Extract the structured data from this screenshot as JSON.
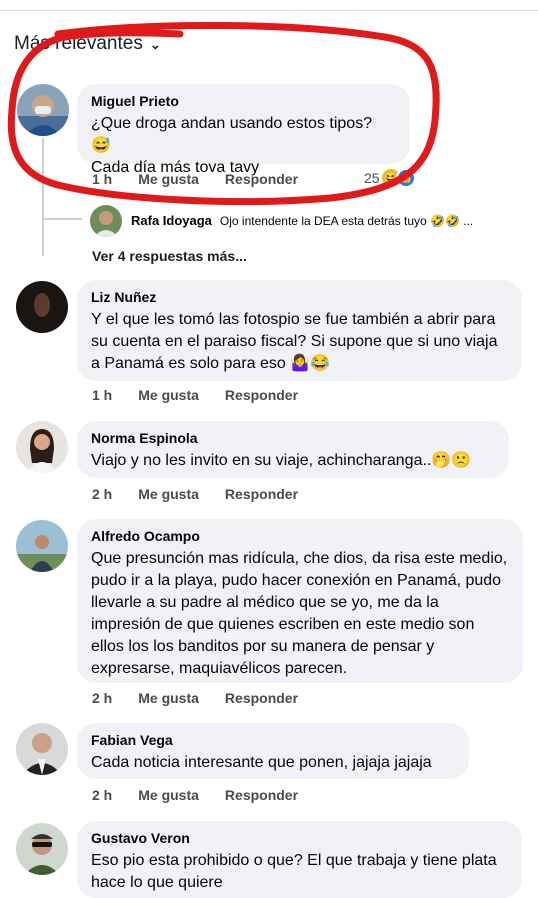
{
  "sort": {
    "label": "Más relevantes"
  },
  "comments": [
    {
      "author": "Miguel Prieto",
      "text": "¿Que droga andan usando estos tipos? 😅\nCada día más tova tavy",
      "time": "1 h",
      "like": "Me gusta",
      "reply": "Responder",
      "reactions": "25"
    },
    {
      "author": "Liz Nuñez",
      "text": "Y el que les tomó las fotospio se fue también a abrir para su cuenta en el paraiso fiscal? Si supone que si uno viaja a Panamá es solo para eso 🤷‍♀️😂",
      "time": "1 h",
      "like": "Me gusta",
      "reply": "Responder"
    },
    {
      "author": "Norma Espinola",
      "text": "Viajo y no les invito en su viaje, achincharanga..🤭🙁",
      "time": "2 h",
      "like": "Me gusta",
      "reply": "Responder"
    },
    {
      "author": "Alfredo Ocampo",
      "text": "Que presunción mas ridícula, che dios, da risa este medio, pudo ir a la playa, pudo hacer conexión en Panamá, pudo llevarle a su padre al médico que se yo, me da la impresión de que quienes escriben en este medio son ellos los los banditos por su manera de pensar y expresarse, maquiavélicos parecen.",
      "time": "2 h",
      "like": "Me gusta",
      "reply": "Responder"
    },
    {
      "author": "Fabian Vega",
      "text": "Cada noticia interesante que ponen, jajaja jajaja",
      "time": "2 h",
      "like": "Me gusta",
      "reply": "Responder"
    },
    {
      "author": "Gustavo Veron",
      "text": "Eso pio esta prohibido o que? El que trabaja y tiene plata hace lo que quiere"
    }
  ],
  "reply_preview": {
    "author": "Rafa Idoyaga",
    "text": "Ojo intendente la DEA esta detrás tuyo 🤣🤣 ..."
  },
  "more_replies": "Ver 4 respuestas más...",
  "colors": {
    "bubble": "#f0f2f5",
    "annotation": "#e0191b",
    "like_blue": "#1877f2"
  }
}
